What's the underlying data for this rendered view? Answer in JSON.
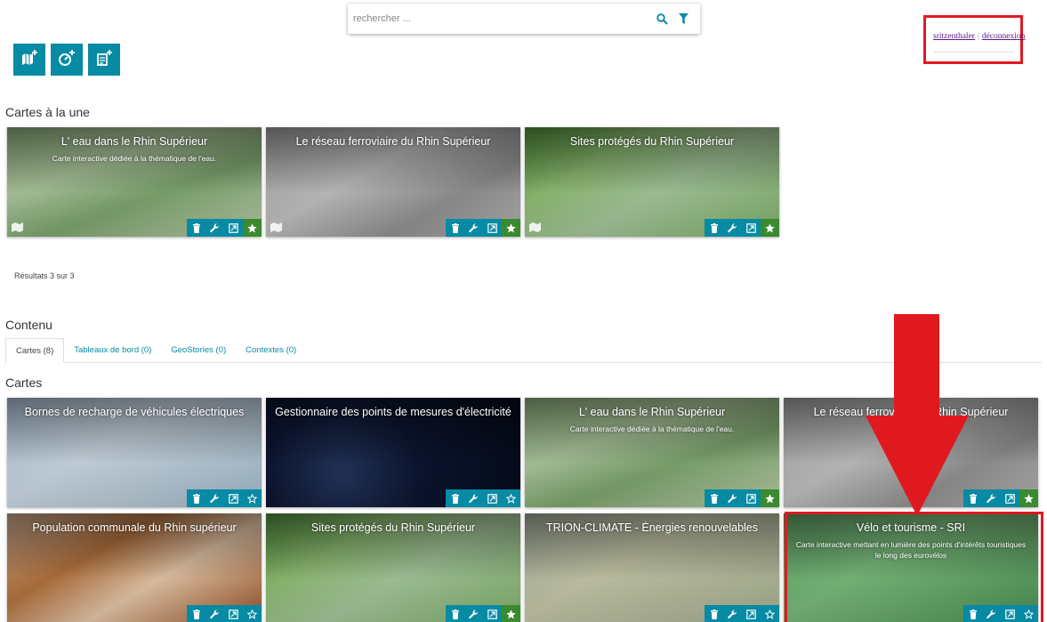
{
  "search": {
    "placeholder": "rechercher ..."
  },
  "user": {
    "username": "sritzenthaler",
    "separator": "|",
    "logout": "déconnexion"
  },
  "featured": {
    "title": "Cartes à la une",
    "results": "Résultats 3 sur 3",
    "cards": [
      {
        "title": "L' eau dans le Rhin Supérieur",
        "description": "Carte interactive dédiée à la thématique de l'eau.",
        "favorite": true
      },
      {
        "title": "Le réseau ferroviaire du Rhin Supérieur",
        "description": "",
        "favorite": true
      },
      {
        "title": "Sites protégés du Rhin Supérieur",
        "description": "",
        "favorite": true
      }
    ]
  },
  "content": {
    "title": "Contenu",
    "tabs": [
      {
        "label": "Cartes (8)",
        "active": true
      },
      {
        "label": "Tableaux de bord (0)",
        "active": false
      },
      {
        "label": "GeoStories (0)",
        "active": false
      },
      {
        "label": "Contextes (0)",
        "active": false
      }
    ],
    "subtitle": "Cartes",
    "cards": [
      {
        "title": "Bornes de recharge de véhicules électriques",
        "description": "",
        "favorite": false
      },
      {
        "title": "Gestionnaire des points de mesures d'électricité",
        "description": "",
        "favorite": false
      },
      {
        "title": "L' eau dans le Rhin Supérieur",
        "description": "Carte interactive dédiée à la thématique de l'eau.",
        "favorite": true
      },
      {
        "title": "Le réseau ferroviaire du Rhin Supérieur",
        "description": "",
        "favorite": true
      },
      {
        "title": "Population communale du Rhin supérieur",
        "description": "",
        "favorite": false
      },
      {
        "title": "Sites protégés du Rhin Supérieur",
        "description": "",
        "favorite": true
      },
      {
        "title": "TRION-CLIMATE - Énergies renouvelables",
        "description": "",
        "favorite": false
      },
      {
        "title": "Vélo et tourisme - SRI",
        "description": "Carte interactive mettant en lumière des points d'intérêts touristiques le long des eurovélos",
        "favorite": false
      }
    ]
  },
  "colors": {
    "accent": "#078aa3",
    "favorite": "#3a8a2f",
    "highlight": "#e0191f"
  },
  "icons": {
    "toolbar": [
      "new-map-icon",
      "new-dashboard-icon",
      "new-geostory-icon"
    ],
    "search": [
      "search-icon",
      "filter-icon"
    ],
    "card_actions": [
      "delete-icon",
      "edit-icon",
      "share-icon",
      "star-icon"
    ]
  }
}
